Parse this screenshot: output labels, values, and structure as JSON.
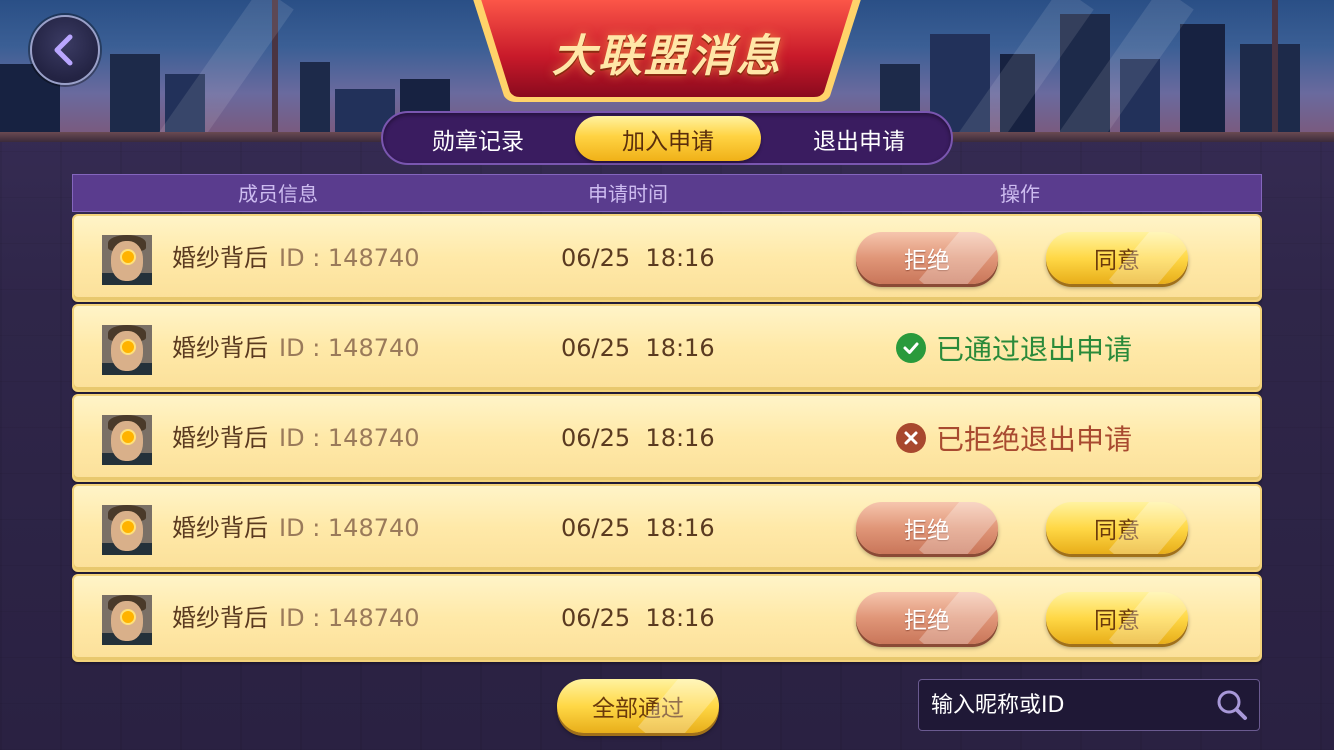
{
  "header": {
    "title": "大联盟消息"
  },
  "tabs": [
    {
      "label": "勋章记录",
      "active": false
    },
    {
      "label": "加入申请",
      "active": true
    },
    {
      "label": "退出申请",
      "active": false
    }
  ],
  "table": {
    "columns": [
      "成员信息",
      "申请时间",
      "操作"
    ],
    "rows": [
      {
        "name": "婚纱背后",
        "id": "ID : 148740",
        "time": "06/25  18:16",
        "action": "buttons"
      },
      {
        "name": "婚纱背后",
        "id": "ID : 148740",
        "time": "06/25  18:16",
        "action": "approved",
        "status_text": "已通过退出申请"
      },
      {
        "name": "婚纱背后",
        "id": "ID : 148740",
        "time": "06/25  18:16",
        "action": "rejected",
        "status_text": "已拒绝退出申请"
      },
      {
        "name": "婚纱背后",
        "id": "ID : 148740",
        "time": "06/25  18:16",
        "action": "buttons"
      },
      {
        "name": "婚纱背后",
        "id": "ID : 148740",
        "time": "06/25  18:16",
        "action": "buttons"
      }
    ],
    "reject_label": "拒绝",
    "agree_label": "同意"
  },
  "footer": {
    "approve_all_label": "全部通过",
    "search_placeholder": "输入昵称或ID"
  },
  "colors": {
    "approved": "#2a8a3a",
    "rejected": "#a84a30",
    "accent_gold": "#ffd343",
    "tab_bg": "#3a1c60"
  },
  "icons": [
    "back-arrow-icon",
    "check-icon",
    "cross-icon",
    "search-icon"
  ]
}
